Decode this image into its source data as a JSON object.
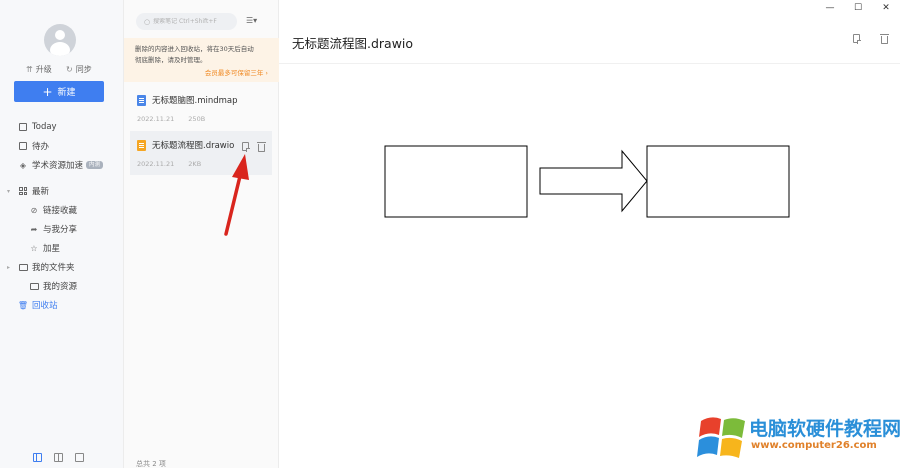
{
  "sidebar": {
    "upgrade_label": "升级",
    "sync_label": "同步",
    "new_button_label": "新建",
    "items": [
      {
        "label": "Today"
      },
      {
        "label": "待办"
      },
      {
        "label": "学术资源加速",
        "badge": "内测"
      },
      {
        "label": "最新"
      },
      {
        "label": "链接收藏"
      },
      {
        "label": "与我分享"
      },
      {
        "label": "加星"
      },
      {
        "label": "我的文件夹"
      },
      {
        "label": "我的资源"
      },
      {
        "label": "回收站"
      }
    ]
  },
  "list": {
    "search_placeholder": "搜索笔记 Ctrl+Shift+F",
    "notice_line1": "删除的内容进入回收站，将在30天后自动",
    "notice_line2": "彻底删除，请及时管理。",
    "notice_link": "会员最多可保留三年 ›",
    "files": [
      {
        "name": "无标题脑图.mindmap",
        "date": "2022.11.21",
        "size": "250B",
        "icon_color": "#4a86e8"
      },
      {
        "name": "无标题流程图.drawio",
        "date": "2022.11.21",
        "size": "2KB",
        "icon_color": "#f5a623"
      }
    ],
    "total_label": "总共 2 项"
  },
  "main": {
    "title": "无标题流程图.drawio",
    "window_controls": [
      "—",
      "☐",
      "✕"
    ]
  },
  "watermark": {
    "text": "电脑软硬件教程网",
    "url": "www.computer26.com"
  },
  "colors": {
    "accent": "#3f7ef0",
    "notice_bg": "#fdf3e6",
    "notice_link": "#f08a24",
    "annotation_arrow": "#d9251d"
  }
}
